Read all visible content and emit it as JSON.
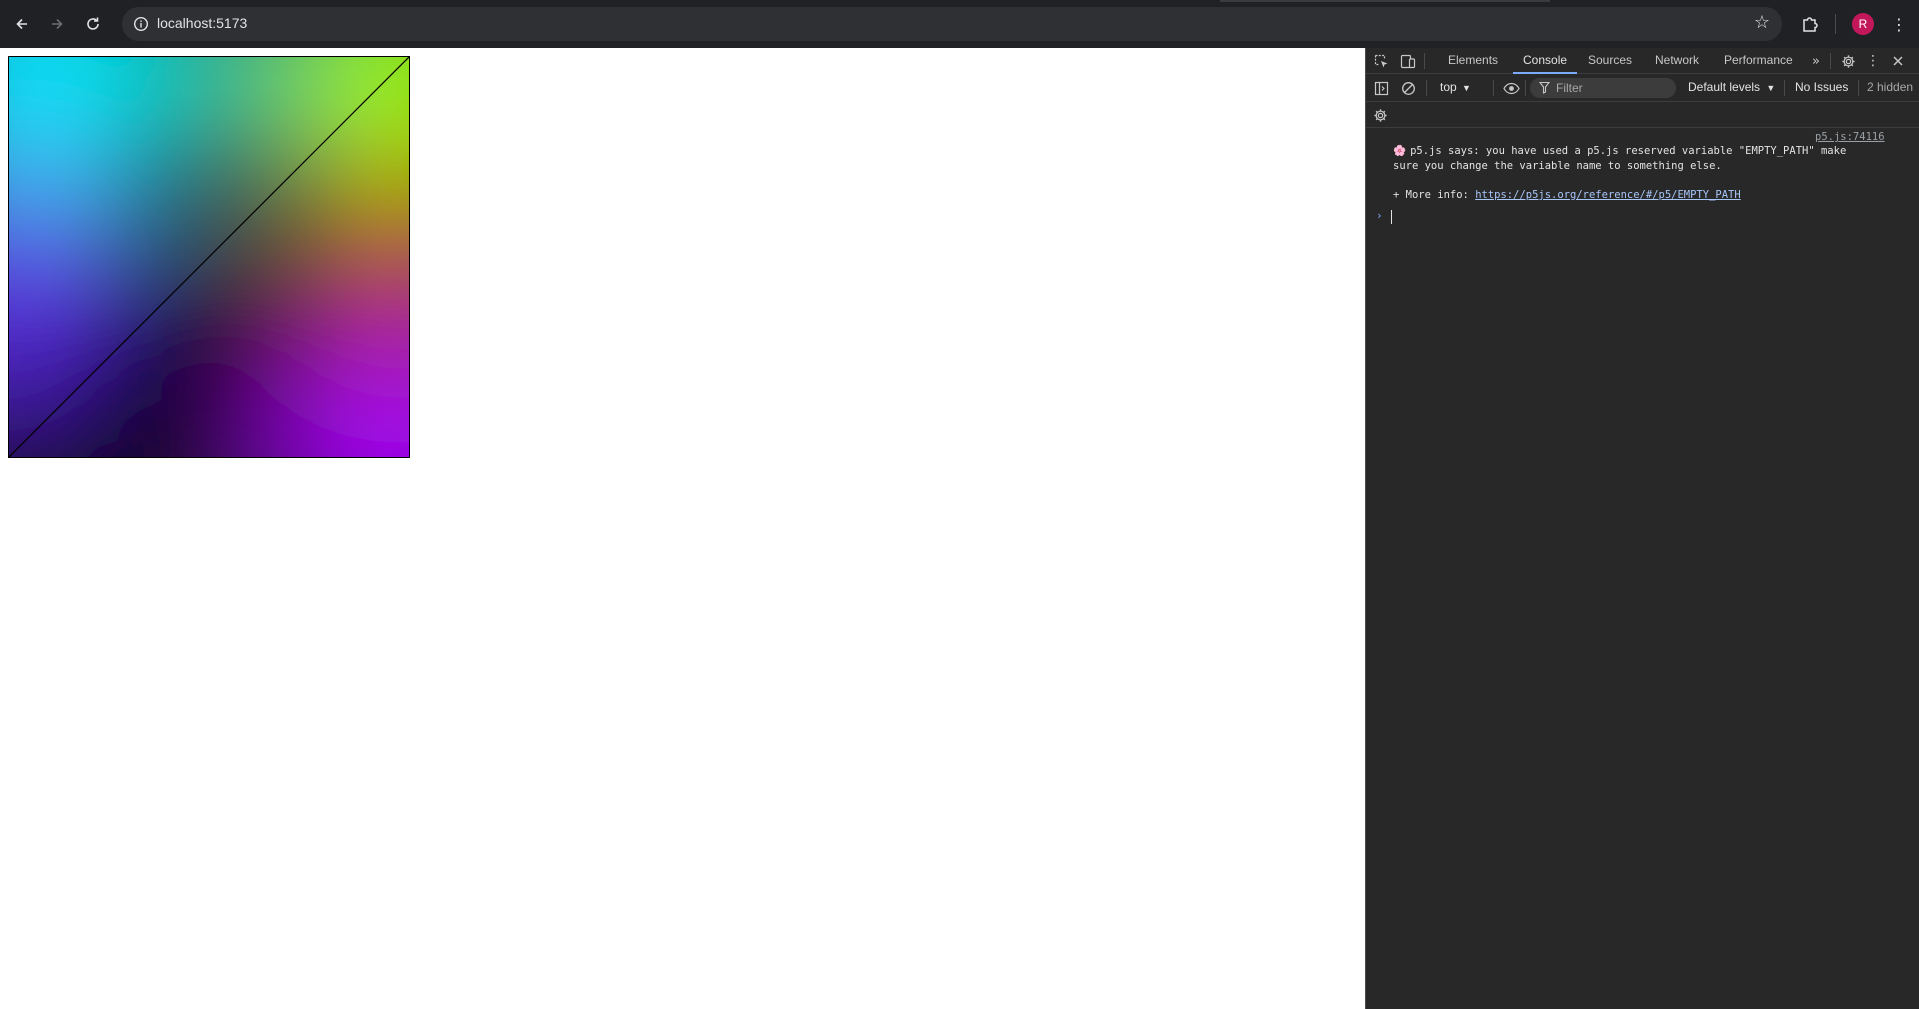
{
  "browser": {
    "url": "localhost:5173",
    "avatar_initial": "R",
    "icons": {
      "back": "arrow-left-icon",
      "forward": "arrow-right-icon",
      "reload": "reload-icon",
      "site_info": "info-icon",
      "bookmark": "star-icon",
      "extensions": "puzzle-icon",
      "menu": "kebab-menu-icon"
    }
  },
  "canvas": {
    "description_colors": {
      "top_left": "#00e5ff",
      "top_right": "#99ff00",
      "bottom_left": "#1a0033",
      "bottom_right": "#aa00ff",
      "center": "#000000",
      "left_mid": "#6633ff",
      "right_mid": "#cc3300",
      "line": "#000000"
    }
  },
  "devtools": {
    "tabs": [
      {
        "label": "Elements",
        "active": false
      },
      {
        "label": "Console",
        "active": true
      },
      {
        "label": "Sources",
        "active": false
      },
      {
        "label": "Network",
        "active": false
      },
      {
        "label": "Performance",
        "active": false
      }
    ],
    "context": "top",
    "filter_placeholder": "Filter",
    "levels": "Default levels",
    "issues": "No Issues",
    "hidden": "2 hidden",
    "accent_color": "#7cacf8",
    "console": {
      "source": "p5.js:74116",
      "message": "p5.js says: you have used a p5.js reserved variable \"EMPTY_PATH\" make\nsure you change the variable name to something else.",
      "more_info_label": "+ More info: ",
      "more_info_link": "https://p5js.org/reference/#/p5/EMPTY_PATH",
      "prompt": "›"
    }
  }
}
